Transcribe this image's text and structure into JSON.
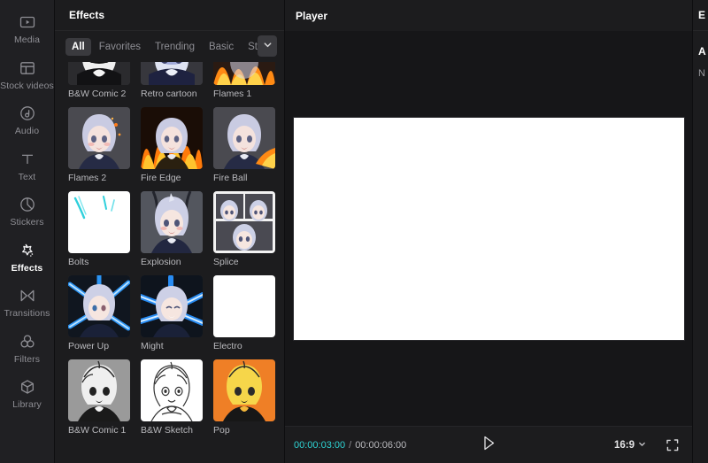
{
  "sidebar": {
    "items": [
      {
        "label": "Media",
        "icon": "media-icon",
        "active": false
      },
      {
        "label": "Stock videos",
        "icon": "stock-videos-icon",
        "active": false
      },
      {
        "label": "Audio",
        "icon": "audio-icon",
        "active": false
      },
      {
        "label": "Text",
        "icon": "text-icon",
        "active": false
      },
      {
        "label": "Stickers",
        "icon": "stickers-icon",
        "active": false
      },
      {
        "label": "Effects",
        "icon": "effects-icon",
        "active": true
      },
      {
        "label": "Transitions",
        "icon": "transitions-icon",
        "active": false
      },
      {
        "label": "Filters",
        "icon": "filters-icon",
        "active": false
      },
      {
        "label": "Library",
        "icon": "library-icon",
        "active": false
      }
    ]
  },
  "effects_panel": {
    "title": "Effects",
    "tabs": [
      {
        "label": "All",
        "active": true
      },
      {
        "label": "Favorites",
        "active": false
      },
      {
        "label": "Trending",
        "active": false
      },
      {
        "label": "Basic",
        "active": false
      },
      {
        "label": "Sta",
        "active": false,
        "clipped": true
      }
    ],
    "more_tabs_icon": "chevron-down-icon",
    "items": [
      {
        "label": "B&W Comic 2",
        "style": "bw-comic",
        "clipped_top": true
      },
      {
        "label": "Retro cartoon",
        "style": "retro",
        "clipped_top": true
      },
      {
        "label": "Flames 1",
        "style": "flames",
        "clipped_top": true
      },
      {
        "label": "Flames 2",
        "style": "portrait",
        "clipped_top": false
      },
      {
        "label": "Fire Edge",
        "style": "fire-edge",
        "clipped_top": false
      },
      {
        "label": "Fire Ball",
        "style": "fire-ball",
        "clipped_top": false
      },
      {
        "label": "Bolts",
        "style": "bolts",
        "clipped_top": false
      },
      {
        "label": "Explosion",
        "style": "explosion",
        "clipped_top": false
      },
      {
        "label": "Splice",
        "style": "splice",
        "clipped_top": false
      },
      {
        "label": "Power Up",
        "style": "power-up",
        "clipped_top": false
      },
      {
        "label": "Might",
        "style": "might",
        "clipped_top": false
      },
      {
        "label": "Electro",
        "style": "white",
        "clipped_top": false
      },
      {
        "label": "B&W Comic 1",
        "style": "bw-comic-1",
        "clipped_top": false
      },
      {
        "label": "B&W Sketch",
        "style": "bw-sketch",
        "clipped_top": false
      },
      {
        "label": "Pop",
        "style": "pop",
        "clipped_top": false
      }
    ]
  },
  "player": {
    "title": "Player",
    "current_time": "00:00:03:00",
    "separator": "/",
    "total_time": "00:00:06:00",
    "play_icon": "play-icon",
    "aspect_ratio": "16:9",
    "aspect_ratio_icon": "chevron-down-icon",
    "fullscreen_icon": "fullscreen-icon"
  },
  "right_panel": {
    "title": "E",
    "section": "A",
    "row": "N"
  },
  "colors": {
    "app_background": "#1c1c1e",
    "rail_background": "#202023",
    "accent_cyan": "#2ed4d4",
    "active_tab_background": "#3a3a3e",
    "text_primary": "#ffffff",
    "text_muted": "#8e8e94",
    "canvas": "#ffffff"
  }
}
